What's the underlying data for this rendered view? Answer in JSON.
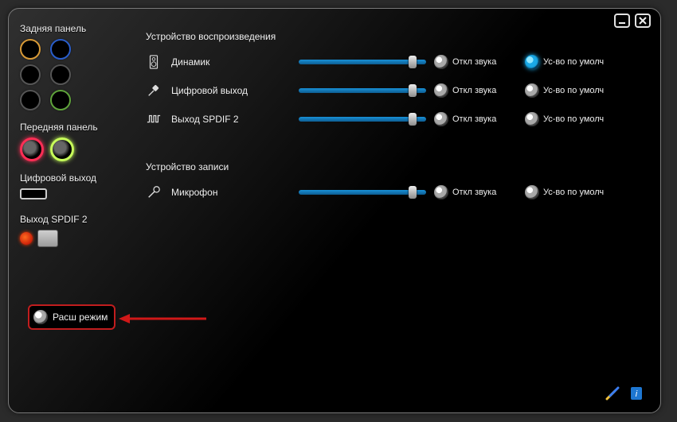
{
  "left": {
    "back_label": "Задняя панель",
    "front_label": "Передняя панель",
    "digital_label": "Цифровой выход",
    "spdif_label": "Выход SPDIF 2"
  },
  "playback": {
    "title": "Устройство воспроизведения",
    "rows": [
      {
        "name": "Динамик",
        "slider": 92,
        "mute": "Откл звука",
        "default": "Ус-во по умолч",
        "is_default": true
      },
      {
        "name": "Цифровой выход",
        "slider": 92,
        "mute": "Откл звука",
        "default": "Ус-во по умолч",
        "is_default": false
      },
      {
        "name": "Выход SPDIF 2",
        "slider": 92,
        "mute": "Откл звука",
        "default": "Ус-во по умолч",
        "is_default": false
      }
    ]
  },
  "record": {
    "title": "Устройство записи",
    "rows": [
      {
        "name": "Микрофон",
        "slider": 92,
        "mute": "Откл звука",
        "default": "Ус-во по умолч",
        "is_default": false
      }
    ]
  },
  "adv_label": "Расш режим"
}
